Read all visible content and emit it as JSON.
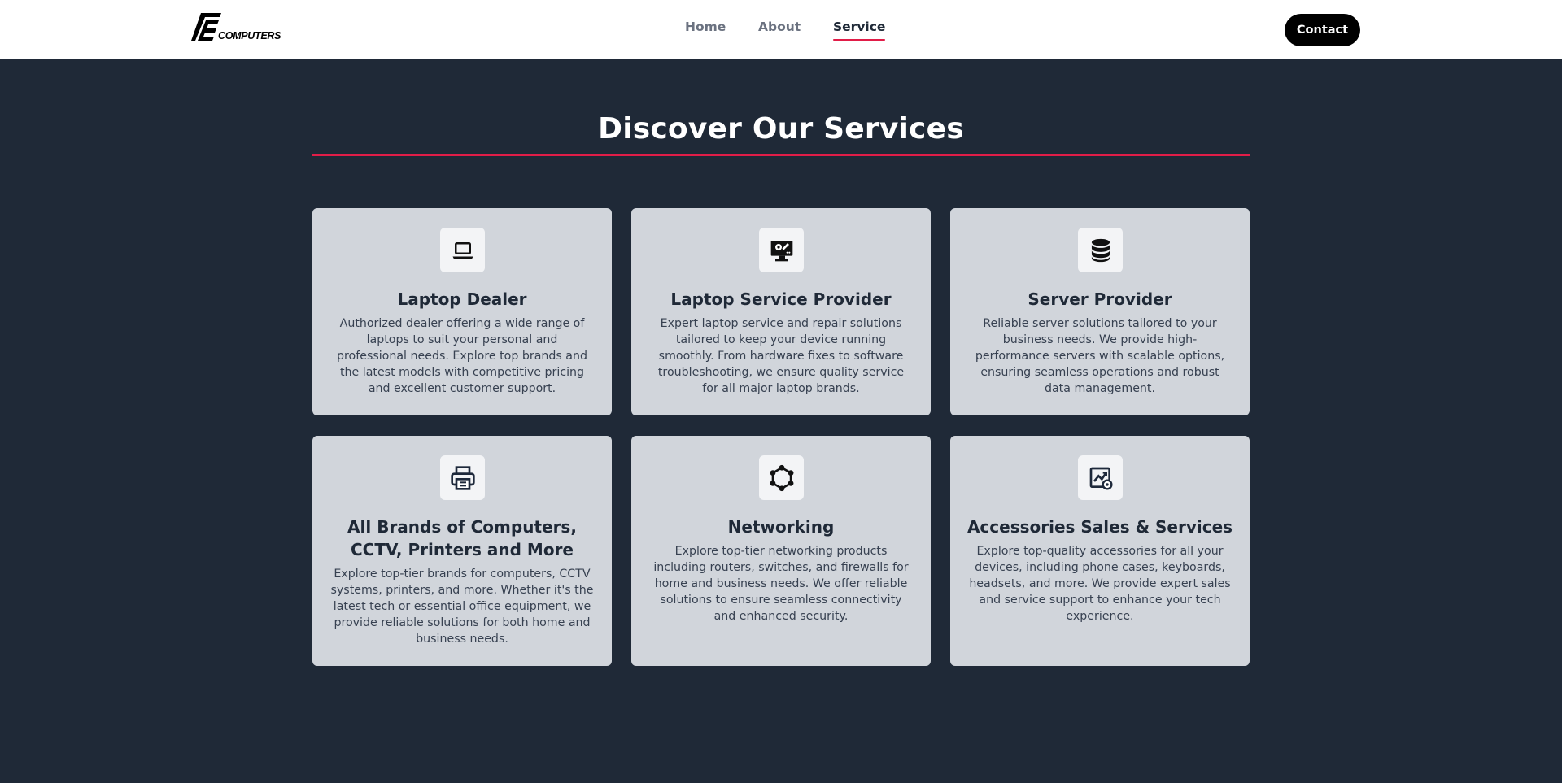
{
  "header": {
    "logo_text": "COMPUTERS",
    "nav": [
      {
        "label": "Home"
      },
      {
        "label": "About"
      },
      {
        "label": "Service",
        "active": true
      }
    ],
    "contact_label": "Contact"
  },
  "main": {
    "title": "Discover Our Services",
    "services": [
      {
        "icon": "laptop-icon",
        "title": "Laptop Dealer",
        "description": "Authorized dealer offering a wide range of laptops to suit your personal and professional needs. Explore top brands and the latest models with competitive pricing and excellent customer support."
      },
      {
        "icon": "monitor-gear-icon",
        "title": "Laptop Service Provider",
        "description": "Expert laptop service and repair solutions tailored to keep your device running smoothly. From hardware fixes to software troubleshooting, we ensure quality service for all major laptop brands."
      },
      {
        "icon": "database-icon",
        "title": "Server Provider",
        "description": "Reliable server solutions tailored to your business needs. We provide high-performance servers with scalable options, ensuring seamless operations and robust data management."
      },
      {
        "icon": "printer-icon",
        "title": "All Brands of Computers, CCTV, Printers and More",
        "description": "Explore top-tier brands for computers, CCTV systems, printers, and more. Whether it's the latest tech or essential office equipment, we provide reliable solutions for both home and business needs."
      },
      {
        "icon": "network-icon",
        "title": "Networking",
        "description": "Explore top-tier networking products including routers, switches, and firewalls for home and business needs. We offer reliable solutions to ensure seamless connectivity and enhanced security."
      },
      {
        "icon": "chart-settings-icon",
        "title": "Accessories Sales & Services",
        "description": "Explore top-quality accessories for all your devices, including phone cases, keyboards, headsets, and more. We provide expert sales and service support to enhance your tech experience."
      }
    ]
  },
  "colors": {
    "background": "#1f2937",
    "header": "#ffffff",
    "accent": "#e11d48",
    "card": "#d1d5db"
  }
}
